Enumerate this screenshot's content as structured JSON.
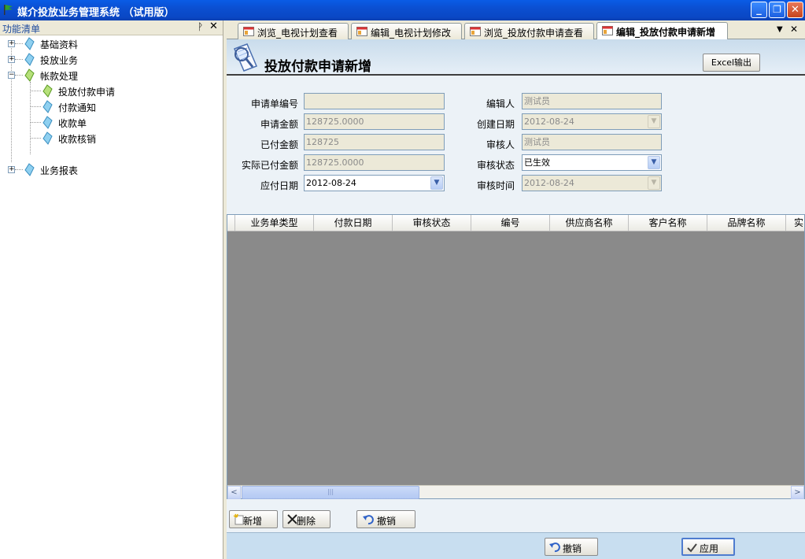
{
  "window": {
    "title": "媒介投放业务管理系统 （试用版）",
    "min_glyph": "_",
    "max_glyph": "❐",
    "close_glyph": "✕"
  },
  "left_panel": {
    "title": "功能清单",
    "pin_glyph": "ᚹ",
    "close_glyph": "✕",
    "tree": [
      {
        "label": "基础资料",
        "expander": "+"
      },
      {
        "label": "投放业务",
        "expander": "+"
      },
      {
        "label": "帐款处理",
        "expander": "−"
      },
      {
        "label": "投放付款申请"
      },
      {
        "label": "付款通知"
      },
      {
        "label": "收款单"
      },
      {
        "label": "收款核销"
      },
      {
        "label": "业务报表",
        "expander": "+"
      }
    ]
  },
  "tabs": [
    {
      "label": "浏览_电视计划查看"
    },
    {
      "label": "编辑_电视计划修改"
    },
    {
      "label": "浏览_投放付款申请查看"
    },
    {
      "label": "编辑_投放付款申请新增"
    }
  ],
  "tab_controls": {
    "dropdown": "▼",
    "close": "✕"
  },
  "form": {
    "title": "投放付款申请新增",
    "excel_button": "Excel输出",
    "fields_left": [
      {
        "label": "申请单编号",
        "value": ""
      },
      {
        "label": "申请金额",
        "value": "128725.0000"
      },
      {
        "label": "已付金额",
        "value": "128725"
      },
      {
        "label": "实际已付金额",
        "value": "128725.0000"
      },
      {
        "label": "应付日期",
        "value": "2012-08-24"
      }
    ],
    "fields_right": [
      {
        "label": "编辑人",
        "value": "测试员"
      },
      {
        "label": "创建日期",
        "value": "2012-08-24"
      },
      {
        "label": "审核人",
        "value": "测试员"
      },
      {
        "label": "审核状态",
        "value": "已生效"
      },
      {
        "label": "审核时间",
        "value": "2012-08-24"
      }
    ]
  },
  "grid": {
    "columns": [
      "业务单类型",
      "付款日期",
      "审核状态",
      "编号",
      "供应商名称",
      "客户名称",
      "品牌名称",
      "实"
    ],
    "scroll_left": "<",
    "scroll_right": ">",
    "thumb_grip": "|||"
  },
  "grid_buttons": {
    "add": "新增",
    "delete": "删除",
    "undo": "撤销"
  },
  "bottom_buttons": {
    "undo": "撤销",
    "apply": "应用"
  }
}
